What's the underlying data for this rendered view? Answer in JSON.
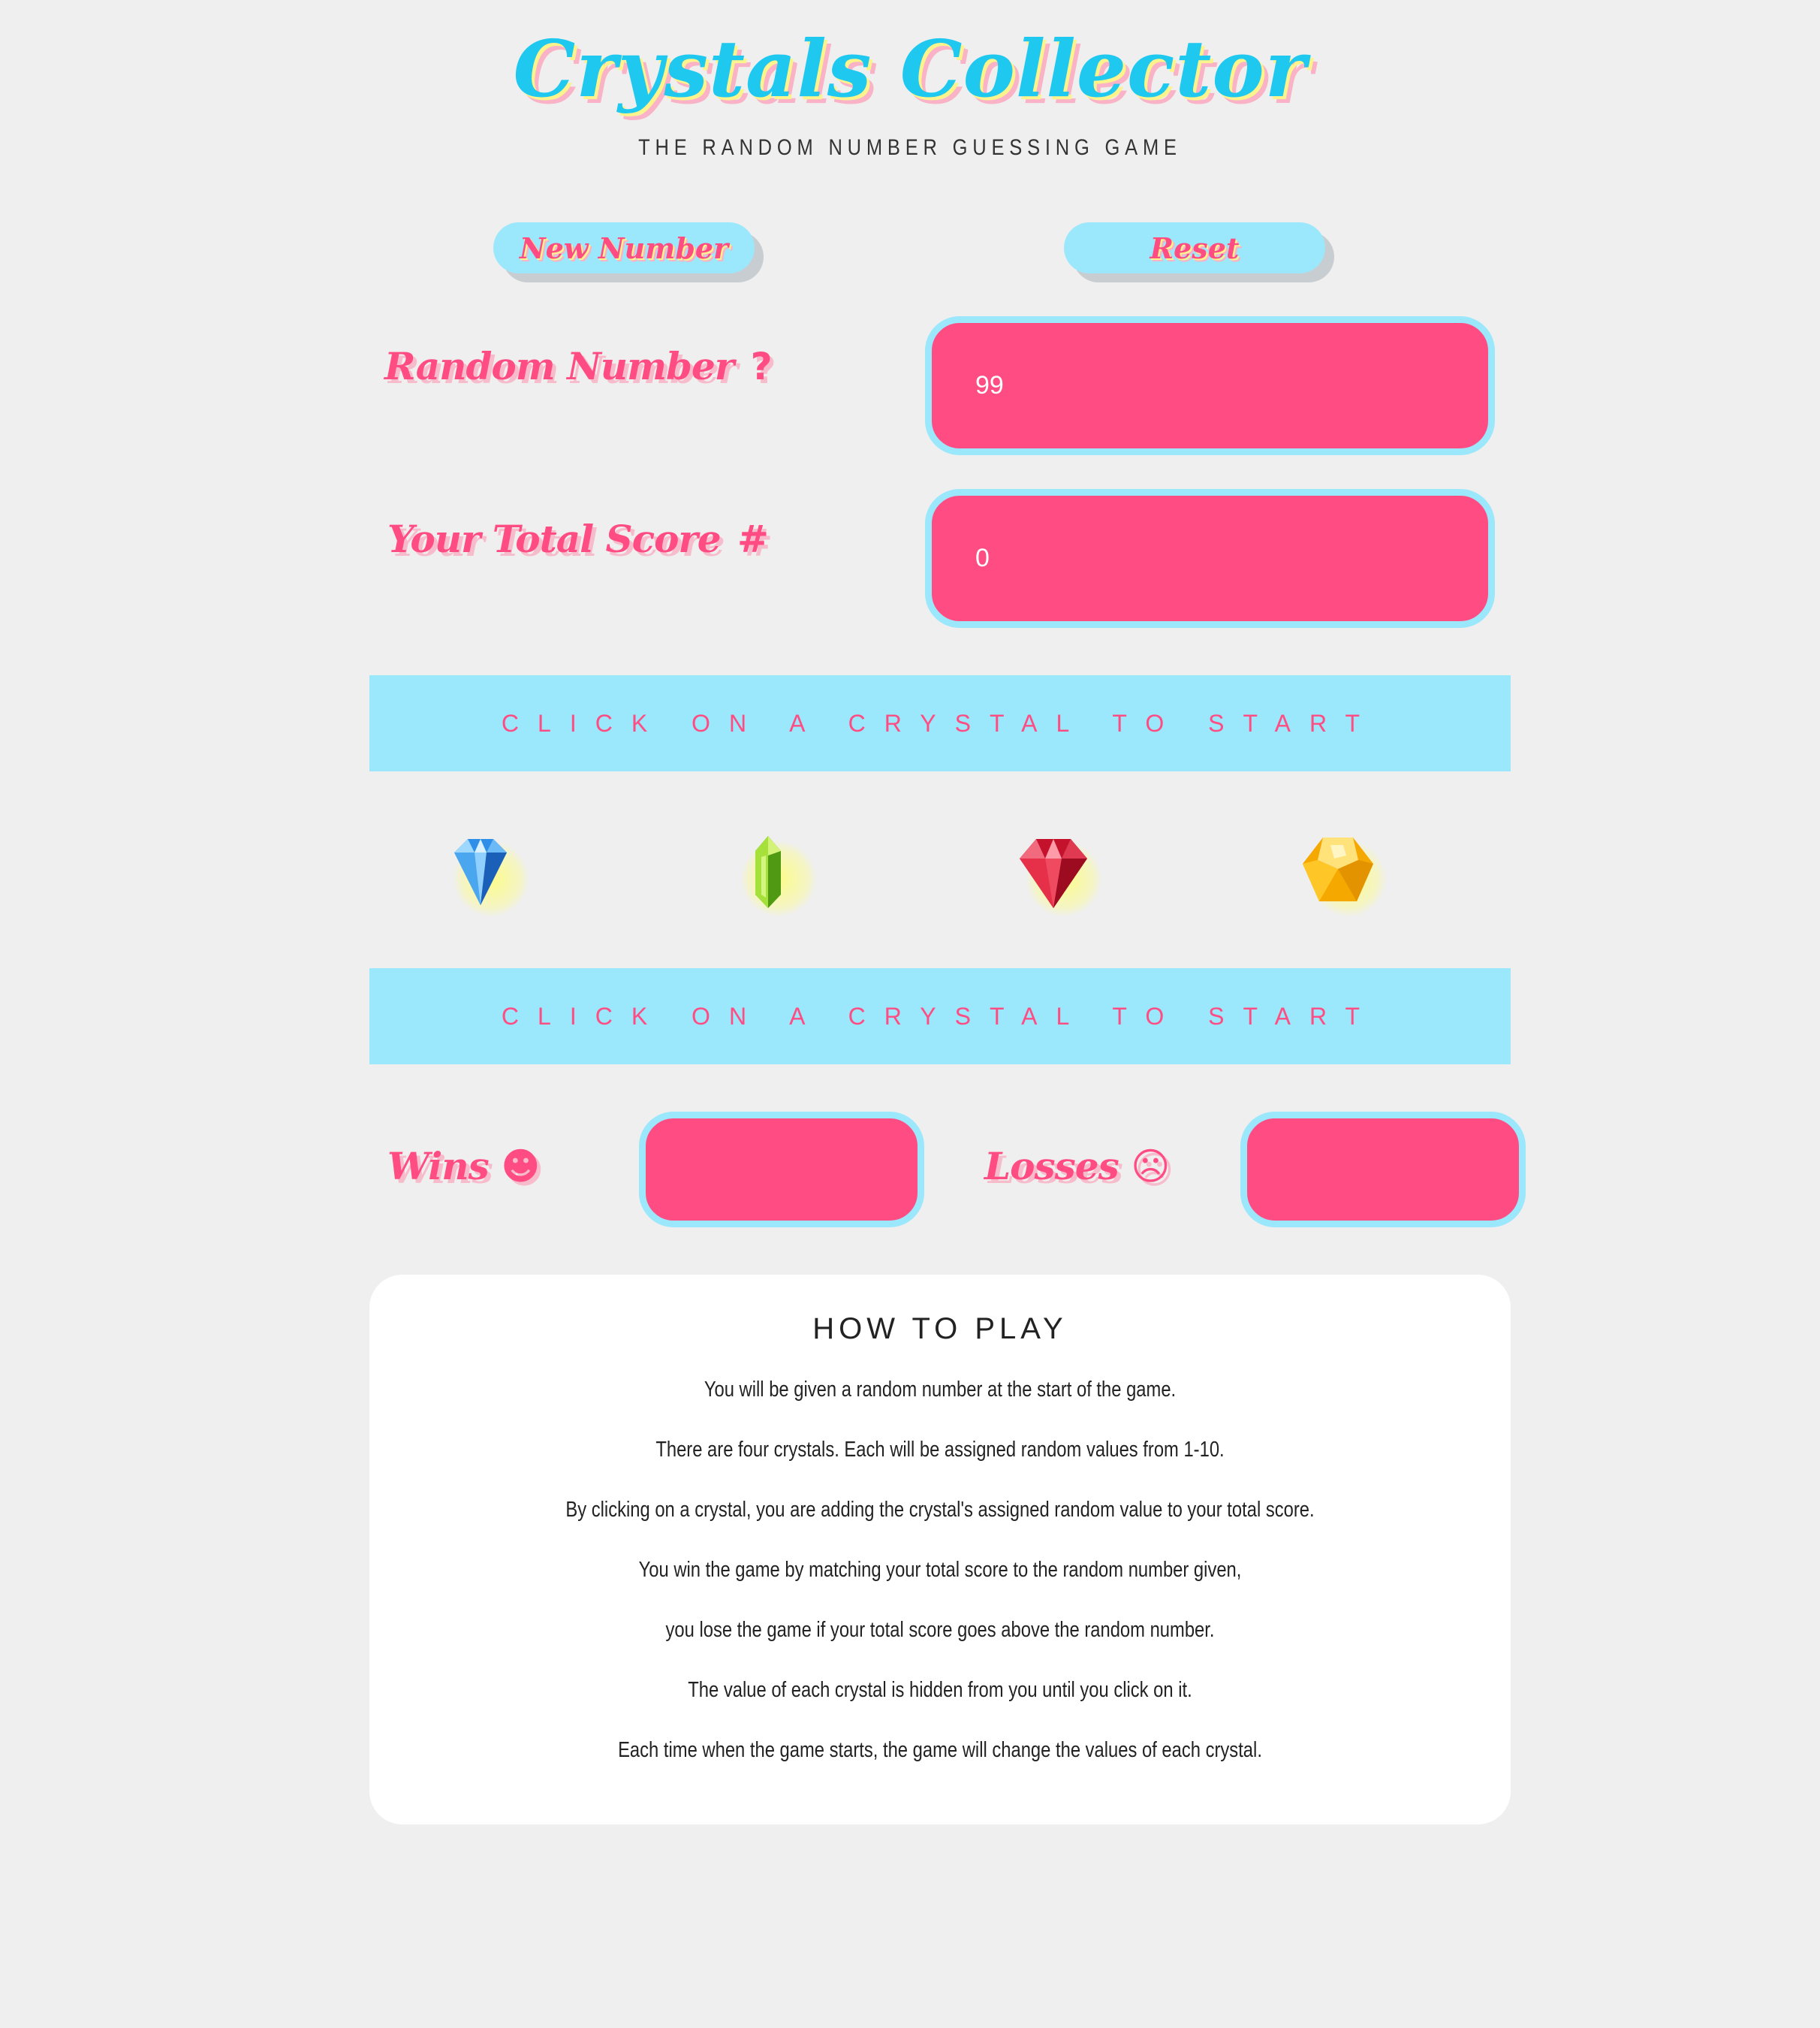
{
  "header": {
    "title": "Crystals Collector",
    "subtitle": "THE RANDOM NUMBER GUESSING GAME"
  },
  "controls": {
    "new_number_label": "New Number",
    "reset_label": "Reset"
  },
  "random_number": {
    "label": "Random Number",
    "icon_glyph": "?",
    "value": "99"
  },
  "total_score": {
    "label": "Your Total Score",
    "icon_glyph": "#",
    "value": "0"
  },
  "status_message": "CLICK ON A CRYSTAL TO START",
  "crystals": [
    {
      "name": "blue diamond",
      "color": "#2f8fe8"
    },
    {
      "name": "green crystal",
      "color": "#6cc417"
    },
    {
      "name": "red ruby",
      "color": "#d81f35"
    },
    {
      "name": "yellow gem",
      "color": "#ffbf1f"
    }
  ],
  "record": {
    "wins_label": "Wins",
    "wins_icon": "smiling-face-icon",
    "wins_value": "",
    "losses_label": "Losses",
    "losses_icon": "frowning-face-icon",
    "losses_value": ""
  },
  "how_to_play": {
    "heading": "HOW TO PLAY",
    "lines": [
      "You will be given a random number at the start of the game.",
      "There are four crystals. Each will be assigned random values from 1-10.",
      "By clicking on a crystal, you are adding the crystal's assigned random value to your total score.",
      "You win the game by matching your total score to the random number given,",
      "you lose the game if your total score goes above the random number.",
      "The value of each crystal is hidden from you until you click on it.",
      "Each time when the game starts, the game will change the values of each crystal."
    ]
  },
  "colors": {
    "background": "#efefef",
    "accent_pink": "#ff4d84",
    "accent_cyan": "#9be7fb",
    "title_cyan": "#1ec8ef"
  }
}
